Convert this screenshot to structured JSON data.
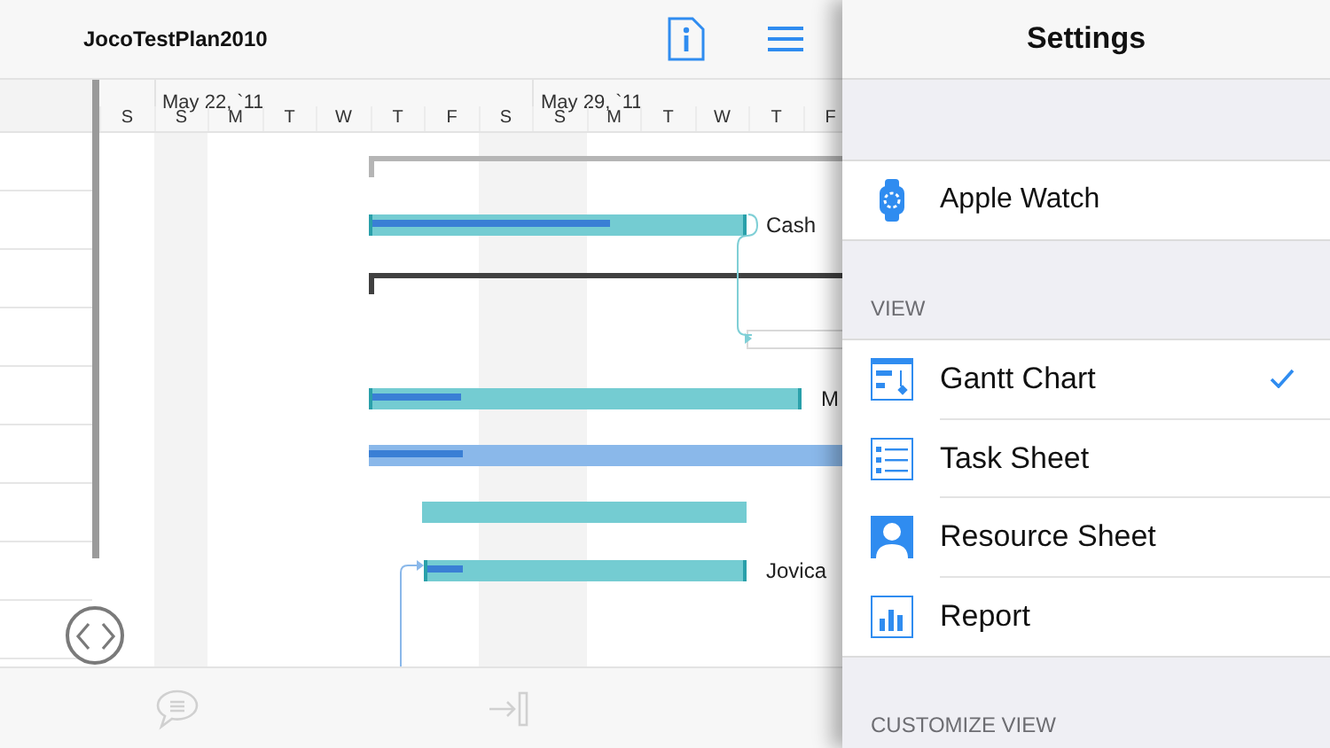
{
  "document": {
    "title": "JocoTestPlan2010"
  },
  "timeline": {
    "weeks": [
      "May 22, `11",
      "May 29, `11"
    ],
    "days": [
      {
        "letter": "S",
        "shaded": false
      },
      {
        "letter": "S",
        "shaded": true
      },
      {
        "letter": "M",
        "shaded": false
      },
      {
        "letter": "T",
        "shaded": false
      },
      {
        "letter": "W",
        "shaded": false
      },
      {
        "letter": "T",
        "shaded": false
      },
      {
        "letter": "F",
        "shaded": false
      },
      {
        "letter": "S",
        "shaded": true
      },
      {
        "letter": "S",
        "shaded": true
      },
      {
        "letter": "M",
        "shaded": false
      },
      {
        "letter": "T",
        "shaded": false
      },
      {
        "letter": "W",
        "shaded": false
      },
      {
        "letter": "T",
        "shaded": false
      },
      {
        "letter": "F",
        "shaded": false
      }
    ]
  },
  "bars": [
    {
      "kind": "summary",
      "dimmed": true
    },
    {
      "kind": "task",
      "level": 0.64,
      "highlighted": false,
      "label": "Cash"
    },
    {
      "kind": "summary",
      "dimmed": false
    },
    {
      "kind": "placeholder"
    },
    {
      "kind": "task",
      "level": 0.21,
      "highlighted": false,
      "label": "M"
    },
    {
      "kind": "task",
      "level": 0.19,
      "highlighted": true
    },
    {
      "kind": "task",
      "highlighted": false
    },
    {
      "kind": "task",
      "level": 0.11,
      "highlighted": false,
      "label": "Jovica"
    }
  ],
  "bottom_toolbar": [
    {
      "kind": "comment",
      "disabled": true
    },
    {
      "kind": "indent",
      "disabled": true
    }
  ],
  "settings": {
    "title": "Settings",
    "items": [
      {
        "kind": "watch",
        "label": "Apple Watch"
      }
    ],
    "sections": [
      {
        "header": "VIEW",
        "items": [
          {
            "kind": "gantt",
            "label": "Gantt Chart",
            "selected": true
          },
          {
            "kind": "tasks",
            "label": "Task Sheet",
            "selected": false
          },
          {
            "kind": "resource",
            "label": "Resource Sheet",
            "selected": false
          },
          {
            "kind": "report",
            "label": "Report",
            "selected": false
          }
        ]
      },
      {
        "header": "CUSTOMIZE VIEW"
      }
    ]
  }
}
